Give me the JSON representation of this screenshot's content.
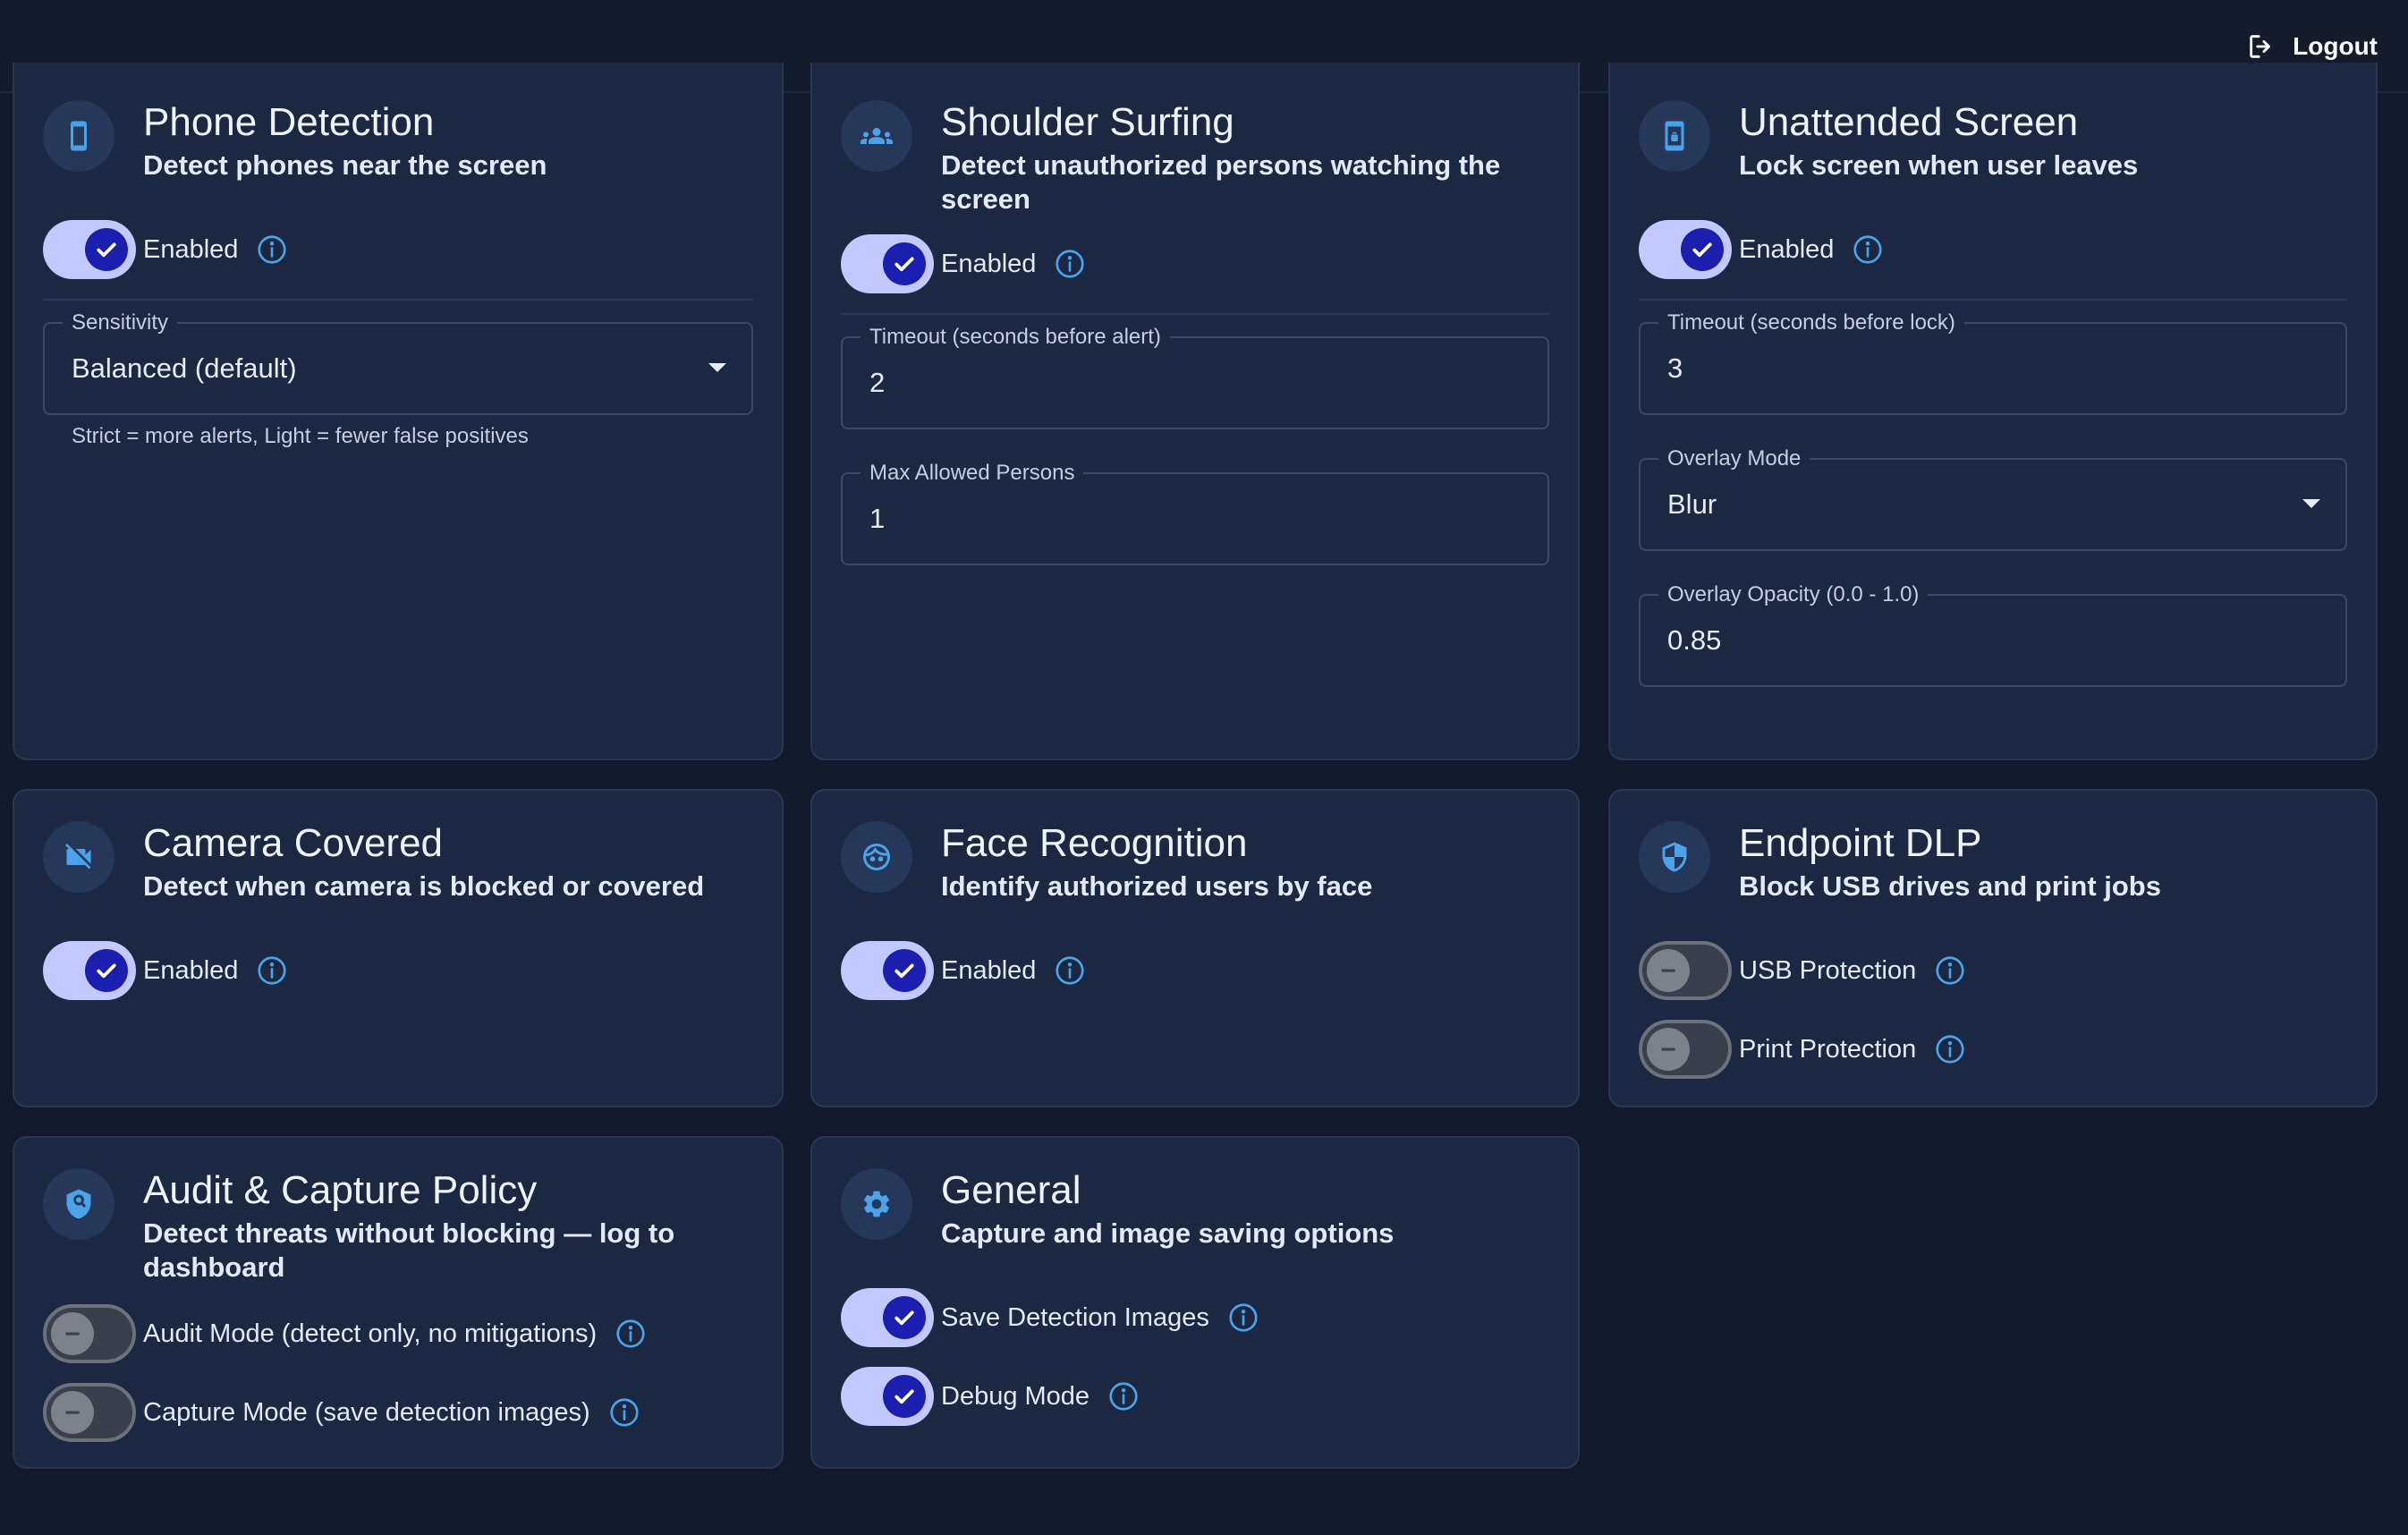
{
  "topbar": {
    "logout_label": "Logout"
  },
  "cards": {
    "phone": {
      "title": "Phone Detection",
      "subtitle": "Detect phones near the screen",
      "enabled_label": "Enabled",
      "enabled": true,
      "sensitivity": {
        "label": "Sensitivity",
        "value": "Balanced (default)",
        "helper": "Strict = more alerts, Light = fewer false positives"
      }
    },
    "shoulder": {
      "title": "Shoulder Surfing",
      "subtitle": "Detect unauthorized persons watching the screen",
      "enabled_label": "Enabled",
      "enabled": true,
      "timeout": {
        "label": "Timeout (seconds before alert)",
        "value": "2"
      },
      "max_persons": {
        "label": "Max Allowed Persons",
        "value": "1"
      }
    },
    "unattended": {
      "title": "Unattended Screen",
      "subtitle": "Lock screen when user leaves",
      "enabled_label": "Enabled",
      "enabled": true,
      "timeout": {
        "label": "Timeout (seconds before lock)",
        "value": "3"
      },
      "overlay_mode": {
        "label": "Overlay Mode",
        "value": "Blur"
      },
      "overlay_opacity": {
        "label": "Overlay Opacity (0.0 - 1.0)",
        "value": "0.85"
      }
    },
    "camera": {
      "title": "Camera Covered",
      "subtitle": "Detect when camera is blocked or covered",
      "enabled_label": "Enabled",
      "enabled": true
    },
    "face": {
      "title": "Face Recognition",
      "subtitle": "Identify authorized users by face",
      "enabled_label": "Enabled",
      "enabled": true
    },
    "dlp": {
      "title": "Endpoint DLP",
      "subtitle": "Block USB drives and print jobs",
      "usb_label": "USB Protection",
      "usb_enabled": false,
      "print_label": "Print Protection",
      "print_enabled": false
    },
    "audit": {
      "title": "Audit & Capture Policy",
      "subtitle": "Detect threats without blocking — log to dashboard",
      "audit_label": "Audit Mode (detect only, no mitigations)",
      "audit_enabled": false,
      "capture_label": "Capture Mode (save detection images)",
      "capture_enabled": false
    },
    "general": {
      "title": "General",
      "subtitle": "Capture and image saving options",
      "save_label": "Save Detection Images",
      "save_enabled": true,
      "debug_label": "Debug Mode",
      "debug_enabled": true
    }
  },
  "colors": {
    "background": "#121a2b",
    "card": "#1c2742",
    "switch_on_track": "#c3c8ff",
    "switch_on_knob": "#1a1fb0",
    "info_icon": "#4aa3e8",
    "avatar_icon": "#4aa3e8"
  },
  "icons": {
    "logout": "logout-icon",
    "phone": "smartphone-icon",
    "shoulder": "group-icon",
    "unattended": "phone-lock-icon",
    "camera": "videocam-off-icon",
    "face": "face-icon",
    "dlp": "shield-icon",
    "audit": "policy-shield-icon",
    "general": "settings-gear-icon"
  }
}
